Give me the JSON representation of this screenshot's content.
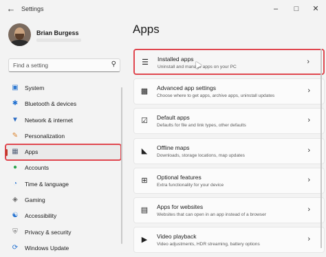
{
  "window": {
    "title": "Settings",
    "back_icon": "arrow-left-icon"
  },
  "user": {
    "name": "Brian Burgess"
  },
  "search": {
    "placeholder": "Find a setting"
  },
  "sidebar": {
    "items": [
      {
        "label": "System",
        "icon": "monitor-icon",
        "active": false
      },
      {
        "label": "Bluetooth & devices",
        "icon": "bluetooth-icon",
        "active": false
      },
      {
        "label": "Network & internet",
        "icon": "wifi-icon",
        "active": false
      },
      {
        "label": "Personalization",
        "icon": "brush-icon",
        "active": false
      },
      {
        "label": "Apps",
        "icon": "apps-icon",
        "active": true
      },
      {
        "label": "Accounts",
        "icon": "person-icon",
        "active": false
      },
      {
        "label": "Time & language",
        "icon": "globe-clock-icon",
        "active": false
      },
      {
        "label": "Gaming",
        "icon": "gamepad-icon",
        "active": false
      },
      {
        "label": "Accessibility",
        "icon": "accessibility-icon",
        "active": false
      },
      {
        "label": "Privacy & security",
        "icon": "shield-icon",
        "active": false
      },
      {
        "label": "Windows Update",
        "icon": "update-icon",
        "active": false
      }
    ]
  },
  "main": {
    "title": "Apps",
    "cards": [
      {
        "title": "Installed apps",
        "subtitle": "Uninstall and manage apps on your PC",
        "icon": "list-icon",
        "highlight": true
      },
      {
        "title": "Advanced app settings",
        "subtitle": "Choose where to get apps, archive apps, uninstall updates",
        "icon": "app-settings-icon",
        "highlight": false
      },
      {
        "title": "Default apps",
        "subtitle": "Defaults for file and link types, other defaults",
        "icon": "default-apps-icon",
        "highlight": false
      },
      {
        "title": "Offline maps",
        "subtitle": "Downloads, storage locations, map updates",
        "icon": "map-icon",
        "highlight": false
      },
      {
        "title": "Optional features",
        "subtitle": "Extra functionality for your device",
        "icon": "grid-plus-icon",
        "highlight": false
      },
      {
        "title": "Apps for websites",
        "subtitle": "Websites that can open in an app instead of a browser",
        "icon": "web-app-icon",
        "highlight": false
      },
      {
        "title": "Video playback",
        "subtitle": "Video adjustments, HDR streaming, battery options",
        "icon": "video-icon",
        "highlight": false
      }
    ]
  },
  "colors": {
    "highlight": "#e0464e",
    "accent": "#c0392b"
  }
}
